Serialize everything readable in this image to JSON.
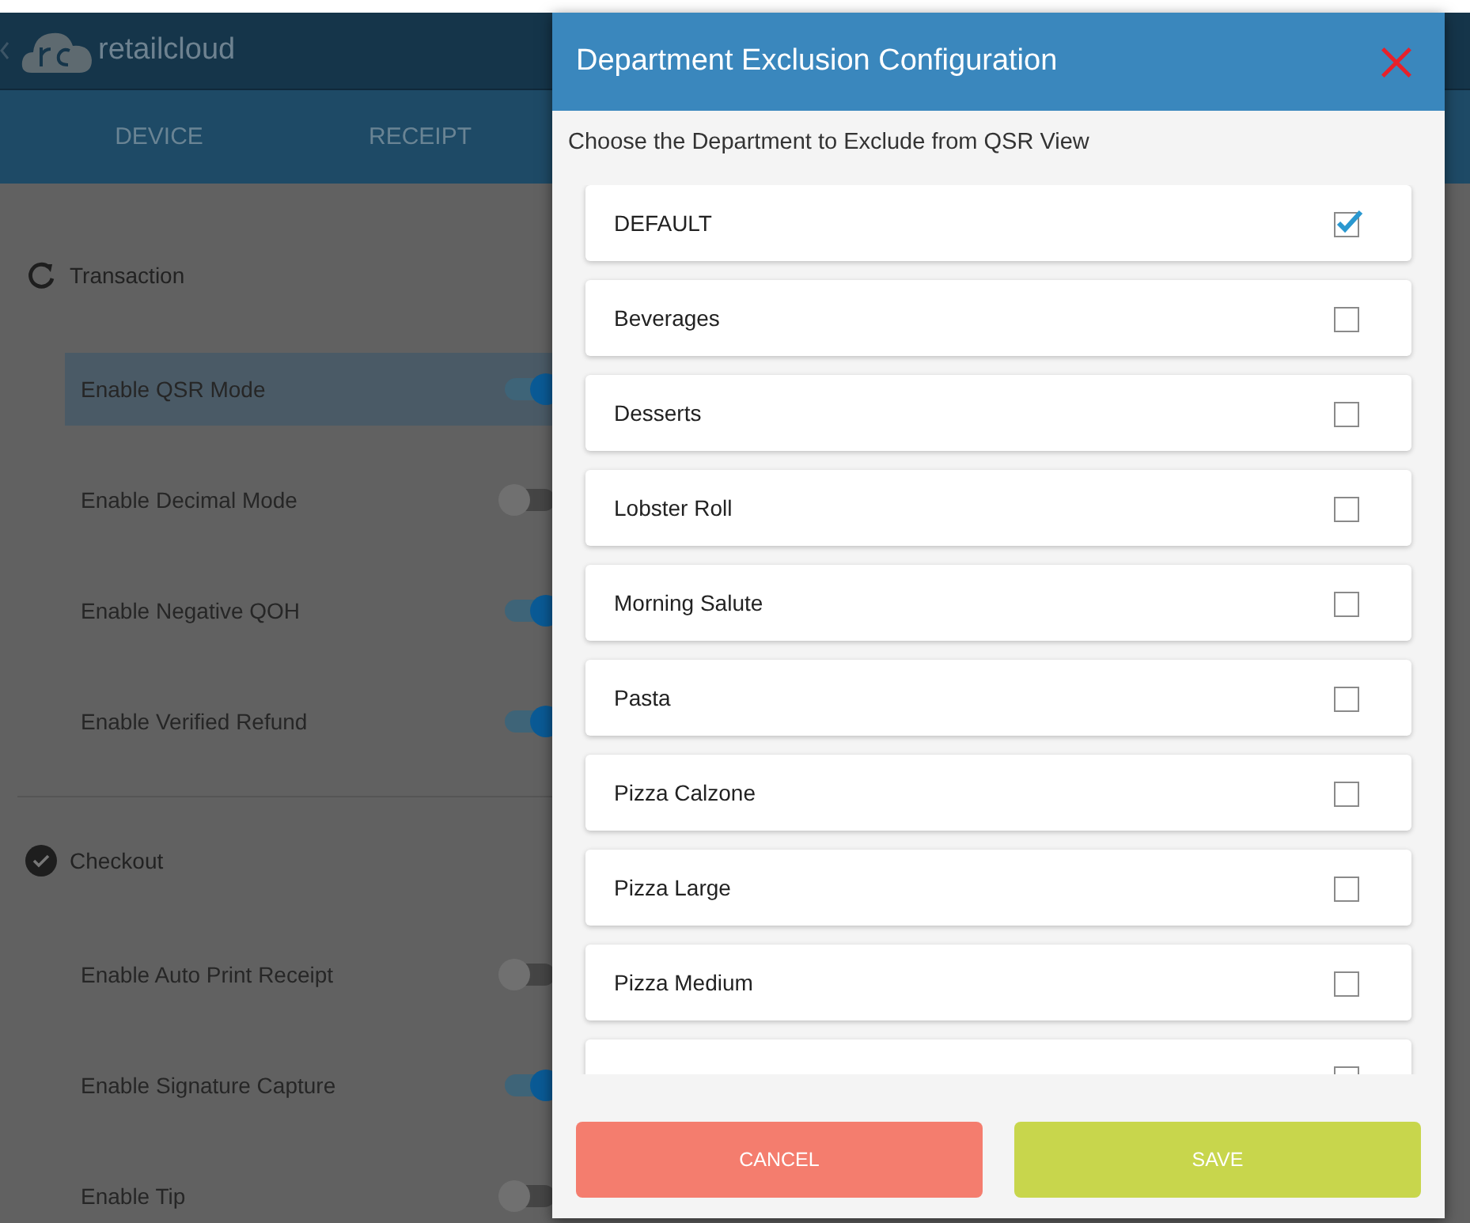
{
  "app": {
    "brand": "retailcloud",
    "tabs": [
      {
        "label": "DEVICE",
        "selected": false
      },
      {
        "label": "RECEIPT",
        "selected": false
      }
    ]
  },
  "settings": [
    {
      "kind": "section",
      "label": "Transaction"
    },
    {
      "kind": "toggle",
      "label": "Enable QSR Mode",
      "on": true,
      "selected": true
    },
    {
      "kind": "toggle",
      "label": "Enable Decimal Mode",
      "on": false,
      "selected": false
    },
    {
      "kind": "toggle",
      "label": "Enable Negative QOH",
      "on": true,
      "selected": false
    },
    {
      "kind": "toggle",
      "label": "Enable Verified Refund",
      "on": true,
      "selected": false
    },
    {
      "kind": "section",
      "label": "Checkout"
    },
    {
      "kind": "toggle",
      "label": "Enable Auto Print Receipt",
      "on": false,
      "selected": false
    },
    {
      "kind": "toggle",
      "label": "Enable Signature Capture",
      "on": true,
      "selected": false
    },
    {
      "kind": "toggle",
      "label": "Enable Tip",
      "on": false,
      "selected": false
    }
  ],
  "dialog": {
    "title": "Department Exclusion Configuration",
    "prompt": "Choose the Department to Exclude from QSR View",
    "departments": [
      {
        "name": "DEFAULT",
        "checked": true
      },
      {
        "name": "Beverages",
        "checked": false
      },
      {
        "name": "Desserts",
        "checked": false
      },
      {
        "name": "Lobster Roll",
        "checked": false
      },
      {
        "name": "Morning Salute",
        "checked": false
      },
      {
        "name": "Pasta",
        "checked": false
      },
      {
        "name": "Pizza Calzone",
        "checked": false
      },
      {
        "name": "Pizza Large",
        "checked": false
      },
      {
        "name": "Pizza Medium",
        "checked": false
      },
      {
        "checked": false
      }
    ],
    "buttons": [
      {
        "label": "CANCEL",
        "kind": "cancel"
      },
      {
        "label": "SAVE",
        "kind": "save"
      }
    ]
  }
}
